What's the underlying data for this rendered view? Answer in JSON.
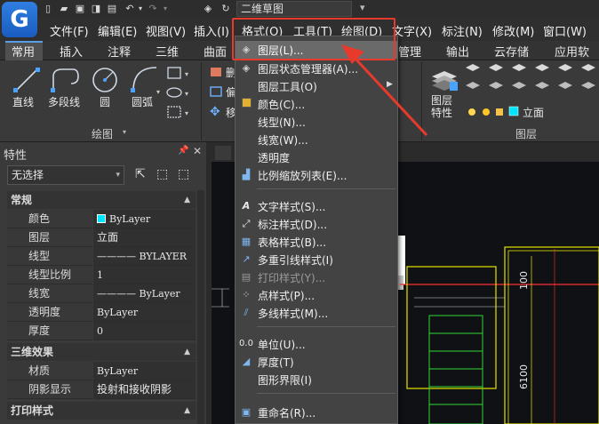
{
  "app": {
    "logo_letter": "G",
    "workspace": "二维草图"
  },
  "menubar": {
    "items": [
      "文件(F)",
      "编辑(E)",
      "视图(V)",
      "插入(I)",
      "格式(O)",
      "工具(T)",
      "绘图(D)",
      "文字(X)",
      "标注(N)",
      "修改(M)",
      "窗口(W)"
    ]
  },
  "ribbon": {
    "tabs": [
      "常用",
      "插入",
      "注释",
      "三维",
      "曲面",
      "管理",
      "输出",
      "云存储",
      "应用软件"
    ],
    "draw_tools": [
      "直线",
      "多段线",
      "圆",
      "圆弧"
    ],
    "draw_panel_title": "绘图",
    "layer_tool": "图层\n特性",
    "layer_current": "立面",
    "layer_panel_title": "图层",
    "partial_labels": [
      "删",
      "偏",
      "移"
    ]
  },
  "properties": {
    "title": "特性",
    "selection": "无选择",
    "sections": {
      "general": "常规",
      "three_d": "三维效果",
      "print": "打印样式"
    },
    "rows_general": [
      {
        "name": "颜色",
        "value": "ByLayer"
      },
      {
        "name": "图层",
        "value": "立面"
      },
      {
        "name": "线型",
        "value": "———— BYLAYER"
      },
      {
        "name": "线型比例",
        "value": "1"
      },
      {
        "name": "线宽",
        "value": "———— ByLayer"
      },
      {
        "name": "透明度",
        "value": "ByLayer"
      },
      {
        "name": "厚度",
        "value": "0"
      }
    ],
    "rows_3d": [
      {
        "name": "材质",
        "value": "ByLayer"
      },
      {
        "name": "阴影显示",
        "value": "投射和接收阴影"
      }
    ]
  },
  "format_menu": {
    "items": [
      {
        "label": "图层(L)...",
        "icon": "layers-icon",
        "highlighted": true,
        "disabled": false
      },
      {
        "label": "图层状态管理器(A)...",
        "icon": "layer-state-icon",
        "disabled": false
      },
      {
        "label": "图层工具(O)",
        "icon": "",
        "disabled": false,
        "submenu": true
      },
      {
        "label": "颜色(C)...",
        "icon": "color-icon",
        "disabled": false
      },
      {
        "label": "线型(N)...",
        "icon": "",
        "disabled": false
      },
      {
        "label": "线宽(W)...",
        "icon": "",
        "disabled": false
      },
      {
        "label": "透明度",
        "icon": "",
        "disabled": false
      },
      {
        "label": "比例缩放列表(E)...",
        "icon": "scale-list-icon",
        "disabled": false
      },
      {
        "label": "文字样式(S)...",
        "icon": "text-style-icon",
        "disabled": false
      },
      {
        "label": "标注样式(D)...",
        "icon": "dim-style-icon",
        "disabled": false
      },
      {
        "label": "表格样式(B)...",
        "icon": "table-style-icon",
        "disabled": false
      },
      {
        "label": "多重引线样式(I)",
        "icon": "mleader-icon",
        "disabled": false
      },
      {
        "label": "打印样式(Y)...",
        "icon": "print-style-icon",
        "disabled": true
      },
      {
        "label": "点样式(P)...",
        "icon": "point-style-icon",
        "disabled": false
      },
      {
        "label": "多线样式(M)...",
        "icon": "mline-style-icon",
        "disabled": false
      },
      {
        "label": "单位(U)...",
        "icon": "units-icon",
        "icon_text": "0.0",
        "disabled": false
      },
      {
        "label": "厚度(T)",
        "icon": "thickness-icon",
        "disabled": false
      },
      {
        "label": "图形界限(I)",
        "icon": "",
        "disabled": false
      },
      {
        "label": "重命名(R)...",
        "icon": "rename-icon",
        "disabled": false
      }
    ]
  },
  "drawing": {
    "dims": [
      "100",
      "6100"
    ]
  },
  "colors": {
    "annotation_red": "#e83a2c",
    "accent_blue": "#5a9fe6",
    "color_swatch": "#00e5ff"
  }
}
